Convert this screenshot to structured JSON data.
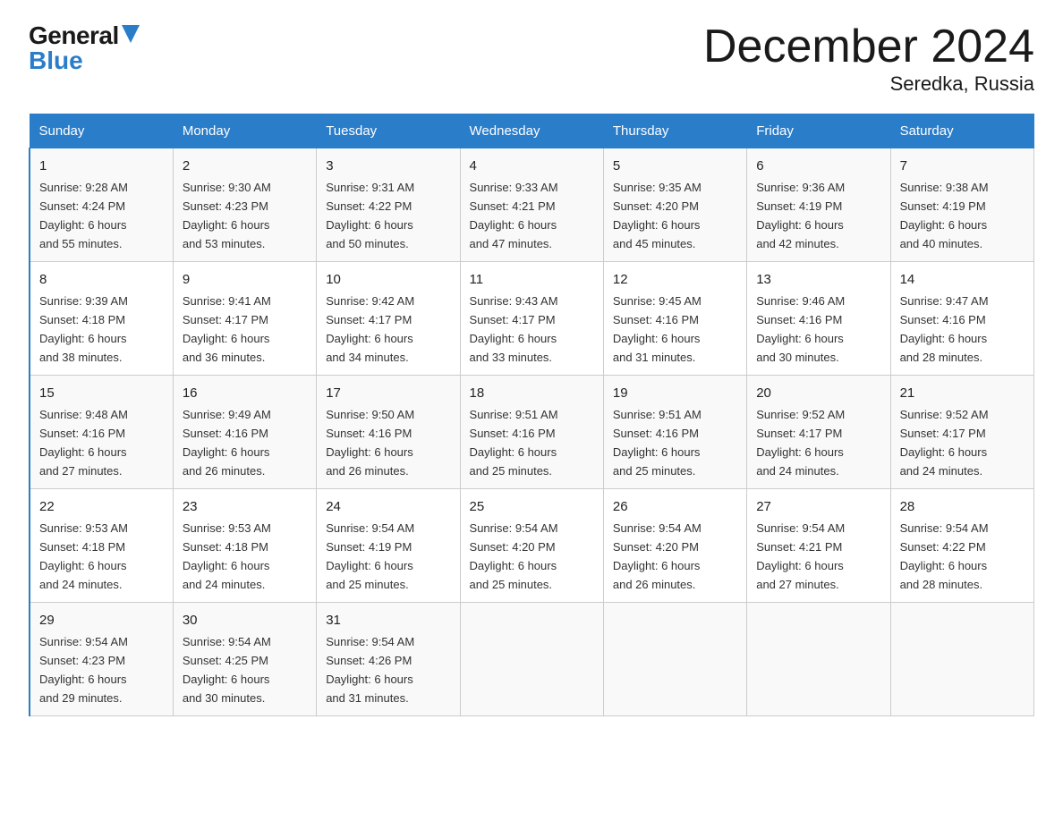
{
  "header": {
    "logo_general": "General",
    "logo_blue": "Blue",
    "title": "December 2024",
    "subtitle": "Seredka, Russia"
  },
  "days_of_week": [
    "Sunday",
    "Monday",
    "Tuesday",
    "Wednesday",
    "Thursday",
    "Friday",
    "Saturday"
  ],
  "weeks": [
    [
      {
        "day": "1",
        "sunrise": "9:28 AM",
        "sunset": "4:24 PM",
        "daylight": "6 hours and 55 minutes."
      },
      {
        "day": "2",
        "sunrise": "9:30 AM",
        "sunset": "4:23 PM",
        "daylight": "6 hours and 53 minutes."
      },
      {
        "day": "3",
        "sunrise": "9:31 AM",
        "sunset": "4:22 PM",
        "daylight": "6 hours and 50 minutes."
      },
      {
        "day": "4",
        "sunrise": "9:33 AM",
        "sunset": "4:21 PM",
        "daylight": "6 hours and 47 minutes."
      },
      {
        "day": "5",
        "sunrise": "9:35 AM",
        "sunset": "4:20 PM",
        "daylight": "6 hours and 45 minutes."
      },
      {
        "day": "6",
        "sunrise": "9:36 AM",
        "sunset": "4:19 PM",
        "daylight": "6 hours and 42 minutes."
      },
      {
        "day": "7",
        "sunrise": "9:38 AM",
        "sunset": "4:19 PM",
        "daylight": "6 hours and 40 minutes."
      }
    ],
    [
      {
        "day": "8",
        "sunrise": "9:39 AM",
        "sunset": "4:18 PM",
        "daylight": "6 hours and 38 minutes."
      },
      {
        "day": "9",
        "sunrise": "9:41 AM",
        "sunset": "4:17 PM",
        "daylight": "6 hours and 36 minutes."
      },
      {
        "day": "10",
        "sunrise": "9:42 AM",
        "sunset": "4:17 PM",
        "daylight": "6 hours and 34 minutes."
      },
      {
        "day": "11",
        "sunrise": "9:43 AM",
        "sunset": "4:17 PM",
        "daylight": "6 hours and 33 minutes."
      },
      {
        "day": "12",
        "sunrise": "9:45 AM",
        "sunset": "4:16 PM",
        "daylight": "6 hours and 31 minutes."
      },
      {
        "day": "13",
        "sunrise": "9:46 AM",
        "sunset": "4:16 PM",
        "daylight": "6 hours and 30 minutes."
      },
      {
        "day": "14",
        "sunrise": "9:47 AM",
        "sunset": "4:16 PM",
        "daylight": "6 hours and 28 minutes."
      }
    ],
    [
      {
        "day": "15",
        "sunrise": "9:48 AM",
        "sunset": "4:16 PM",
        "daylight": "6 hours and 27 minutes."
      },
      {
        "day": "16",
        "sunrise": "9:49 AM",
        "sunset": "4:16 PM",
        "daylight": "6 hours and 26 minutes."
      },
      {
        "day": "17",
        "sunrise": "9:50 AM",
        "sunset": "4:16 PM",
        "daylight": "6 hours and 26 minutes."
      },
      {
        "day": "18",
        "sunrise": "9:51 AM",
        "sunset": "4:16 PM",
        "daylight": "6 hours and 25 minutes."
      },
      {
        "day": "19",
        "sunrise": "9:51 AM",
        "sunset": "4:16 PM",
        "daylight": "6 hours and 25 minutes."
      },
      {
        "day": "20",
        "sunrise": "9:52 AM",
        "sunset": "4:17 PM",
        "daylight": "6 hours and 24 minutes."
      },
      {
        "day": "21",
        "sunrise": "9:52 AM",
        "sunset": "4:17 PM",
        "daylight": "6 hours and 24 minutes."
      }
    ],
    [
      {
        "day": "22",
        "sunrise": "9:53 AM",
        "sunset": "4:18 PM",
        "daylight": "6 hours and 24 minutes."
      },
      {
        "day": "23",
        "sunrise": "9:53 AM",
        "sunset": "4:18 PM",
        "daylight": "6 hours and 24 minutes."
      },
      {
        "day": "24",
        "sunrise": "9:54 AM",
        "sunset": "4:19 PM",
        "daylight": "6 hours and 25 minutes."
      },
      {
        "day": "25",
        "sunrise": "9:54 AM",
        "sunset": "4:20 PM",
        "daylight": "6 hours and 25 minutes."
      },
      {
        "day": "26",
        "sunrise": "9:54 AM",
        "sunset": "4:20 PM",
        "daylight": "6 hours and 26 minutes."
      },
      {
        "day": "27",
        "sunrise": "9:54 AM",
        "sunset": "4:21 PM",
        "daylight": "6 hours and 27 minutes."
      },
      {
        "day": "28",
        "sunrise": "9:54 AM",
        "sunset": "4:22 PM",
        "daylight": "6 hours and 28 minutes."
      }
    ],
    [
      {
        "day": "29",
        "sunrise": "9:54 AM",
        "sunset": "4:23 PM",
        "daylight": "6 hours and 29 minutes."
      },
      {
        "day": "30",
        "sunrise": "9:54 AM",
        "sunset": "4:25 PM",
        "daylight": "6 hours and 30 minutes."
      },
      {
        "day": "31",
        "sunrise": "9:54 AM",
        "sunset": "4:26 PM",
        "daylight": "6 hours and 31 minutes."
      },
      null,
      null,
      null,
      null
    ]
  ],
  "labels": {
    "sunrise": "Sunrise:",
    "sunset": "Sunset:",
    "daylight": "Daylight:"
  }
}
